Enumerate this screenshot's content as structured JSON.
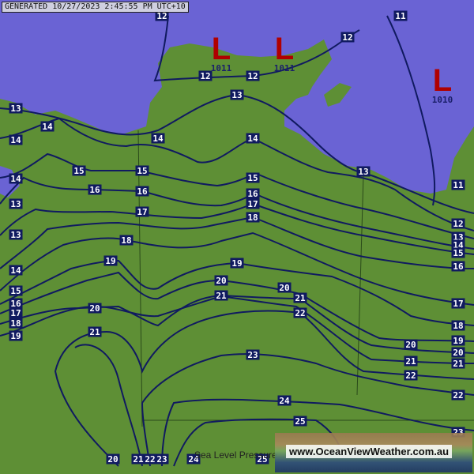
{
  "header": {
    "generated": "GENERATED 10/27/2023 2:45:55 PM UTC+10"
  },
  "footer": {
    "title": "Sea Level Pressure",
    "watermark": "www.OceanViewWeather.com.au"
  },
  "colors": {
    "sea": "#6a63d4",
    "land": "#5e8f35",
    "isobar": "#101a60",
    "low": "#b00000"
  },
  "lows": [
    {
      "letter": "L",
      "pressure": "1011"
    },
    {
      "letter": "L",
      "pressure": "1011"
    },
    {
      "letter": "L",
      "pressure": "1010"
    }
  ],
  "isobar_labels": [
    "11",
    "12",
    "13",
    "14",
    "15",
    "16",
    "17",
    "18",
    "19",
    "20",
    "21",
    "22",
    "23",
    "24",
    "25"
  ]
}
